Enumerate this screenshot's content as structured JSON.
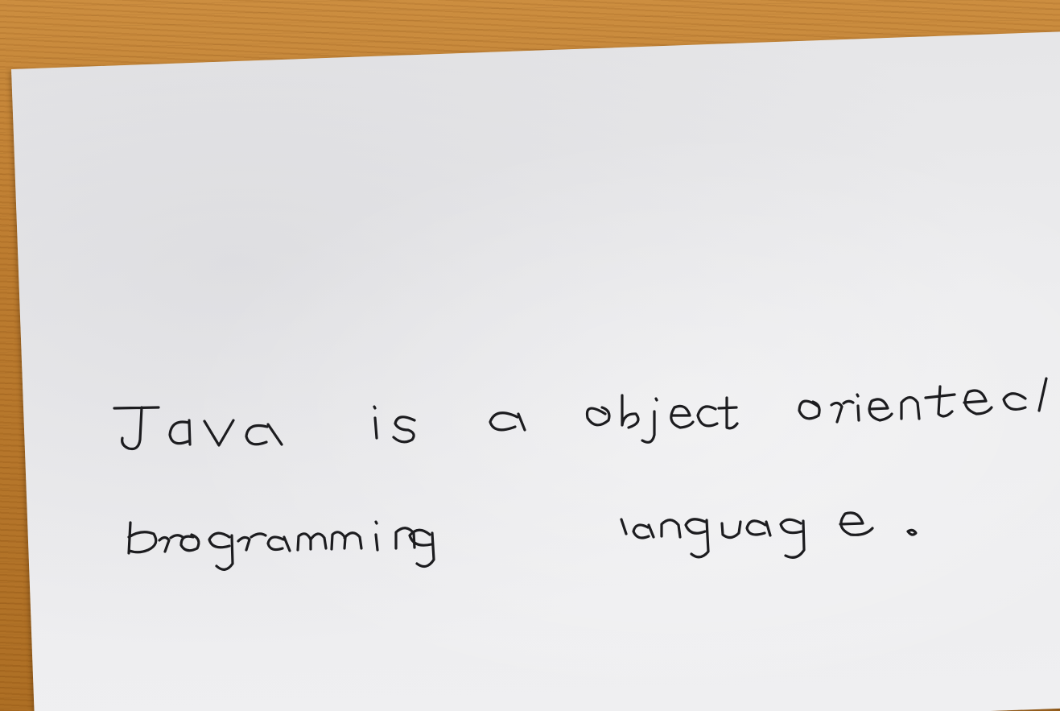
{
  "note": {
    "line1": "Java is a object oriented",
    "line2": "programming language."
  },
  "colors": {
    "desk": "#b9782c",
    "paper": "#ececee",
    "ink": "#1c1c1f"
  }
}
